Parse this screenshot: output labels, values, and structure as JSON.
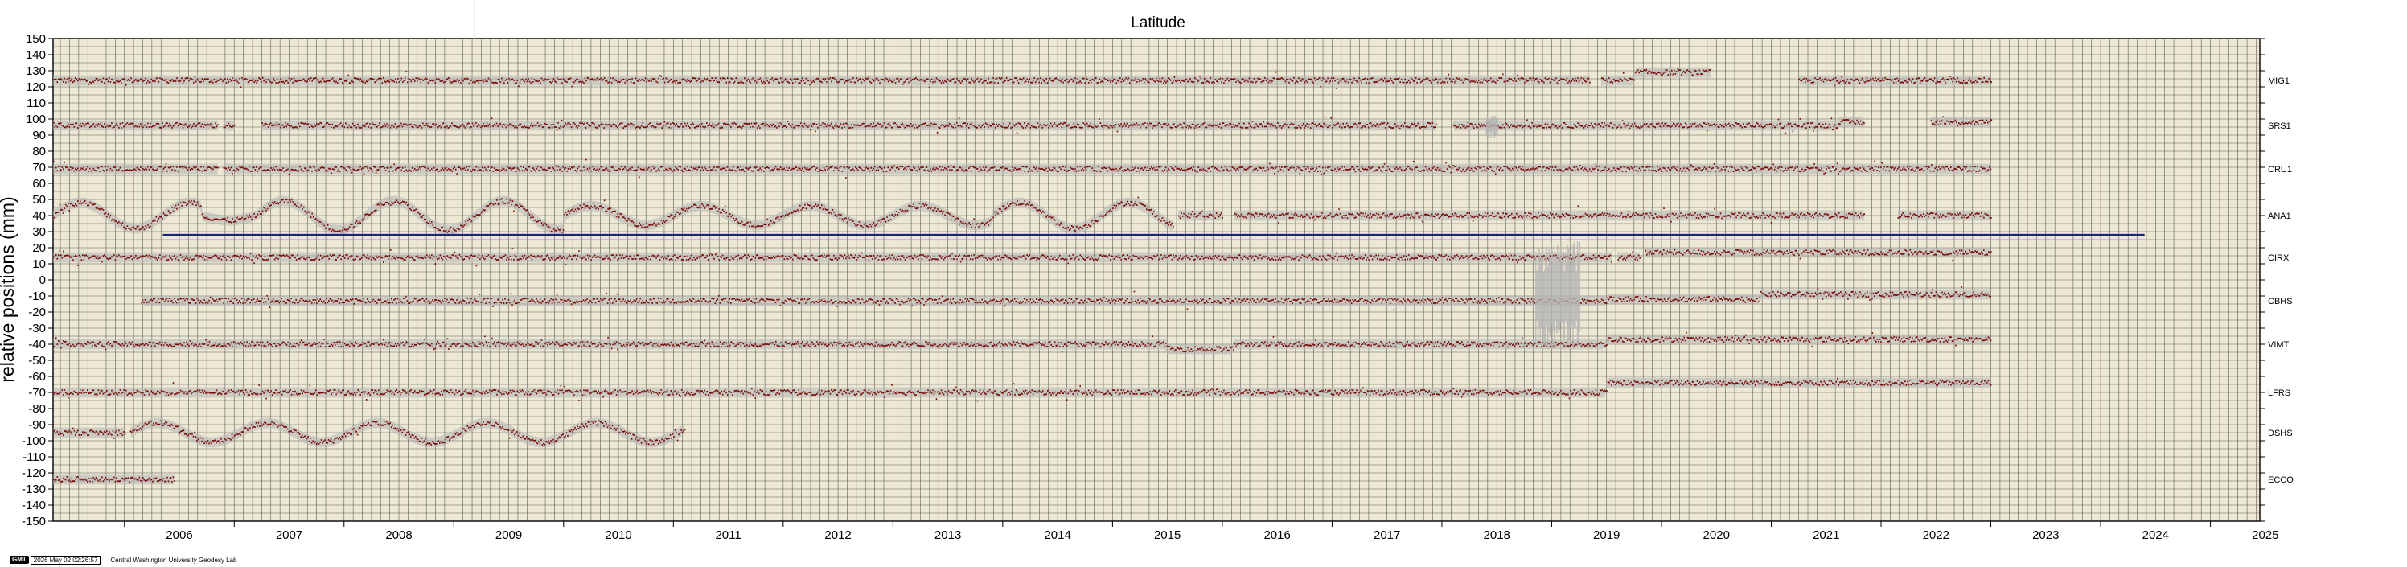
{
  "chart_data": {
    "type": "scatter",
    "title": "Latitude",
    "ylabel": "relative positions (mm)",
    "xlabel": "",
    "xlim": [
      2005.35,
      2025.45
    ],
    "ylim": [
      -150,
      150
    ],
    "ytick_step": 10,
    "grid": true,
    "xticks": [
      "2006",
      "2007",
      "2008",
      "2009",
      "2010",
      "2011",
      "2012",
      "2013",
      "2014",
      "2015",
      "2016",
      "2017",
      "2018",
      "2019",
      "2020",
      "2021",
      "2022",
      "2023",
      "2024",
      "2025"
    ],
    "yticks": [
      "150",
      "140",
      "130",
      "120",
      "110",
      "100",
      "90",
      "80",
      "70",
      "60",
      "50",
      "40",
      "30",
      "20",
      "10",
      "0",
      "-10",
      "-20",
      "-30",
      "-40",
      "-50",
      "-60",
      "-70",
      "-80",
      "-90",
      "-100",
      "-110",
      "-120",
      "-130",
      "-140",
      "-150"
    ],
    "colors": {
      "background": "#ece8d3",
      "points": "#7a0a0a",
      "uncertainty": "#b4b4b4",
      "grid": "#2f2f2f",
      "reference_line": "#1a237e"
    },
    "reference_line": {
      "y": 28,
      "x_start": 2006.35,
      "x_end": 2024.4
    },
    "series": [
      {
        "name": "MIG1",
        "offset": 124,
        "segments": [
          [
            2005.35,
            2019.35
          ],
          [
            2019.45,
            2020.45
          ],
          [
            2021.25,
            2023.0
          ]
        ],
        "shifts": [
          [
            2019.75,
            2020.45,
            5
          ]
        ]
      },
      {
        "name": "SRS1",
        "offset": 96,
        "segments": [
          [
            2005.35,
            2006.85
          ],
          [
            2006.9,
            2007.0
          ],
          [
            2007.25,
            2017.95
          ],
          [
            2018.1,
            2021.85
          ],
          [
            2022.45,
            2023.0
          ]
        ],
        "shifts": [
          [
            2021.6,
            2021.85,
            2
          ],
          [
            2022.45,
            2023.0,
            2
          ]
        ]
      },
      {
        "name": "CRU1",
        "offset": 69,
        "segments": [
          [
            2005.35,
            2006.85
          ],
          [
            2006.9,
            2023.0
          ]
        ],
        "shifts": []
      },
      {
        "name": "ANA1",
        "offset": 40,
        "segments": [
          [
            2005.35,
            2015.55
          ],
          [
            2015.6,
            2016.0
          ],
          [
            2016.1,
            2021.85
          ],
          [
            2022.15,
            2023.0
          ]
        ],
        "shifts": [],
        "waves": [
          [
            2005.35,
            2006.7,
            8
          ],
          [
            2006.7,
            2007.2,
            -3
          ],
          [
            2007.2,
            2010.0,
            9
          ],
          [
            2010.0,
            2013.9,
            6
          ],
          [
            2013.9,
            2015.55,
            8
          ]
        ]
      },
      {
        "name": "CIRX",
        "offset": 14,
        "segments": [
          [
            2005.35,
            2019.55
          ],
          [
            2019.6,
            2019.8
          ],
          [
            2019.85,
            2023.0
          ]
        ],
        "shifts": [
          [
            2019.85,
            2023.0,
            3
          ]
        ]
      },
      {
        "name": "CBHS",
        "offset": -13,
        "segments": [
          [
            2006.15,
            2023.0
          ]
        ],
        "shifts": [
          [
            2019.5,
            2020.9,
            1
          ],
          [
            2020.9,
            2023.0,
            4
          ]
        ]
      },
      {
        "name": "VIMT",
        "offset": -40,
        "segments": [
          [
            2005.35,
            2023.0
          ]
        ],
        "shifts": [
          [
            2015.5,
            2016.1,
            -3
          ],
          [
            2019.5,
            2023.0,
            3
          ]
        ]
      },
      {
        "name": "LFRS",
        "offset": -70,
        "segments": [
          [
            2005.35,
            2023.0
          ]
        ],
        "shifts": [
          [
            2019.5,
            2023.0,
            6
          ]
        ]
      },
      {
        "name": "DSHS",
        "offset": -95,
        "segments": [
          [
            2005.35,
            2006.0
          ],
          [
            2006.05,
            2011.1
          ]
        ],
        "shifts": [],
        "waves": [
          [
            2006.05,
            2011.1,
            6
          ]
        ]
      },
      {
        "name": "ECCO",
        "offset": -124,
        "segments": [
          [
            2005.35,
            2006.45
          ]
        ],
        "shifts": []
      }
    ]
  },
  "footer": {
    "logo": "GMT",
    "timestamp": "2026 May 02 02:26:57",
    "credit": "Central Washington University Geodesy Lab"
  }
}
